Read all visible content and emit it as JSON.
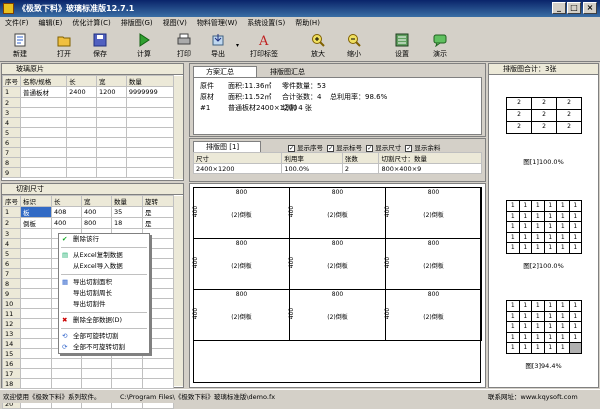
{
  "app": {
    "title": "《极致下料》玻璃标准版12.7.1"
  },
  "menu": [
    "文件(F)",
    "编辑(E)",
    "优化计算(C)",
    "排版图(G)",
    "视图(V)",
    "物料管理(W)",
    "系统设置(S)",
    "帮助(H)"
  ],
  "toolbar": {
    "new": "新建",
    "open": "打开",
    "save": "保存",
    "calc": "计算",
    "print": "打印",
    "export": "导出",
    "print_label": "打印标签",
    "zoom_in": "放大",
    "zoom_out": "缩小",
    "settings": "设置",
    "demo": "演示"
  },
  "raw": {
    "title": "玻璃原片",
    "headers": [
      "序号",
      "名称/规格",
      "长",
      "宽",
      "数量"
    ],
    "rows": [
      [
        "1",
        "普通板材",
        "2400",
        "1200",
        "9999999"
      ],
      [
        "2",
        "",
        "",
        "",
        ""
      ],
      [
        "3",
        "",
        "",
        "",
        ""
      ],
      [
        "4",
        "",
        "",
        "",
        ""
      ],
      [
        "5",
        "",
        "",
        "",
        ""
      ],
      [
        "6",
        "",
        "",
        "",
        ""
      ],
      [
        "7",
        "",
        "",
        "",
        ""
      ],
      [
        "8",
        "",
        "",
        "",
        ""
      ],
      [
        "9",
        "",
        "",
        "",
        ""
      ]
    ]
  },
  "cut": {
    "title": "切割尺寸",
    "headers": [
      "序号",
      "标识",
      "长",
      "宽",
      "数量",
      "旋转"
    ],
    "rows": [
      [
        "1",
        "板",
        "408",
        "400",
        "35",
        "是"
      ],
      [
        "2",
        "倒板",
        "400",
        "800",
        "18",
        "是"
      ],
      [
        "3",
        "",
        "",
        "",
        "",
        ""
      ],
      [
        "4",
        "",
        "",
        "",
        "",
        ""
      ],
      [
        "5",
        "",
        "",
        "",
        "",
        ""
      ],
      [
        "6",
        "",
        "",
        "",
        "",
        ""
      ],
      [
        "7",
        "",
        "",
        "",
        "",
        ""
      ],
      [
        "8",
        "",
        "",
        "",
        "",
        ""
      ],
      [
        "9",
        "",
        "",
        "",
        "",
        ""
      ],
      [
        "10",
        "",
        "",
        "",
        "",
        ""
      ],
      [
        "11",
        "",
        "",
        "",
        "",
        ""
      ],
      [
        "12",
        "",
        "",
        "",
        "",
        ""
      ],
      [
        "13",
        "",
        "",
        "",
        "",
        ""
      ],
      [
        "14",
        "",
        "",
        "",
        "",
        ""
      ],
      [
        "15",
        "",
        "",
        "",
        "",
        ""
      ],
      [
        "16",
        "",
        "",
        "",
        "",
        ""
      ],
      [
        "17",
        "",
        "",
        "",
        "",
        ""
      ],
      [
        "18",
        "",
        "",
        "",
        "",
        ""
      ],
      [
        "19",
        "",
        "",
        "",
        "",
        ""
      ],
      [
        "20",
        "",
        "",
        "",
        "",
        ""
      ]
    ]
  },
  "context_menu": {
    "delete_row": "删除该行",
    "excel_copy": "从Excel复制数据",
    "excel_import": "从Excel导入数据",
    "export_area": "导出切割面积",
    "export_perimeter": "导出切割周长",
    "export_pieces": "导出切割件",
    "delete_all": "删除全部数据(D)",
    "all_rotate": "全部可旋转切割",
    "all_no_rotate": "全部不可旋转切割"
  },
  "summary": {
    "tab1": "方案汇总",
    "tab2": "排版图汇总",
    "rows": [
      [
        "原件",
        "面积:11.36㎡",
        "零件数量：53",
        ""
      ],
      [
        "原材",
        "面积:11.52㎡",
        "合计张数：4",
        "总利用率：98.6%"
      ],
      [
        "#1",
        "普通板材2400×1200",
        "切割 4 张",
        ""
      ]
    ]
  },
  "layout": {
    "tab": "排版图 [1]",
    "checks": [
      "显示序号",
      "显示标号",
      "显示尺寸",
      "显示余料"
    ],
    "headers": [
      "尺寸",
      "利用率",
      "张数",
      "切割尺寸：数量"
    ],
    "row": [
      "2400×1200",
      "100.0%",
      "2",
      "800×400×9"
    ],
    "piece_top": "800",
    "piece_side": "400",
    "piece_label": "(2)倒板"
  },
  "right": {
    "title": "排版图合计：3张",
    "p1_cells": [
      "2",
      "2",
      "2",
      "2",
      "2",
      "2",
      "2",
      "2",
      "2"
    ],
    "p1_caption": "图[1]100.0%",
    "p2_cell": "1",
    "p2_caption": "图[2]100.0%",
    "p3_caption": "图[3]94.4%"
  },
  "status": {
    "welcome": "欢迎使用《极致下料》系列软件。",
    "path": "C:\\Program Files\\《极致下料》玻璃标准版\\demo.fx",
    "site": "联系网址：www.kqysoft.com"
  }
}
